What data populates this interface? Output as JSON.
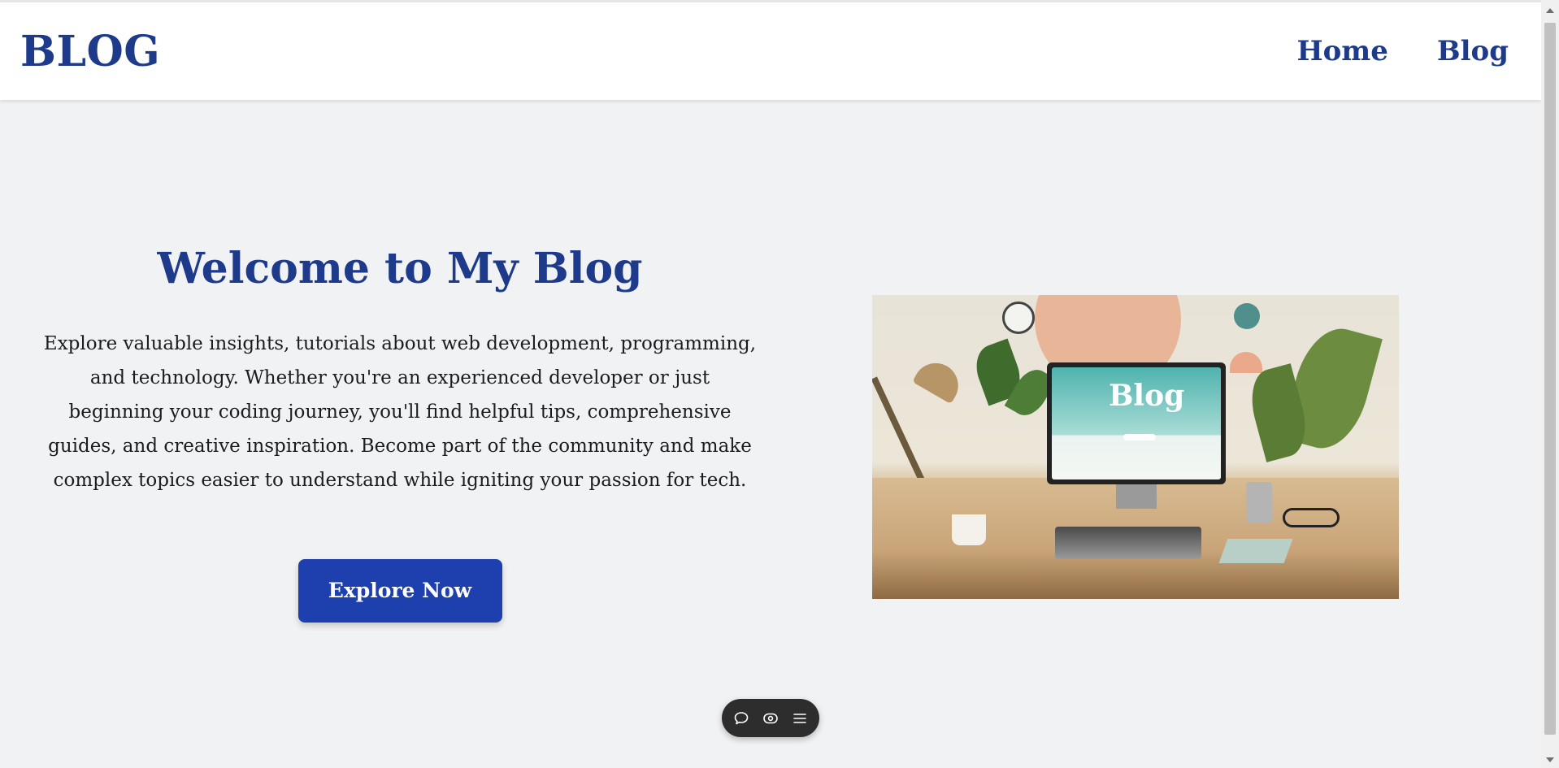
{
  "header": {
    "logo": "BLOG",
    "nav": [
      {
        "label": "Home"
      },
      {
        "label": "Blog"
      }
    ]
  },
  "hero": {
    "title": "Welcome to My Blog",
    "description": "Explore valuable insights, tutorials about web development, programming, and technology. Whether you're an experienced developer or just beginning your coding journey, you'll find helpful tips, comprehensive guides, and creative inspiration. Become part of the community and make complex topics easier to understand while igniting your passion for tech.",
    "cta_label": "Explore Now",
    "image_screen_text": "Blog"
  },
  "floating_toolbar": {
    "icons": [
      "chat-bubble-icon",
      "eye-icon",
      "menu-icon"
    ]
  },
  "colors": {
    "brand_blue": "#1e3a8a",
    "button_blue": "#1e40af",
    "page_bg": "#f1f2f4"
  }
}
